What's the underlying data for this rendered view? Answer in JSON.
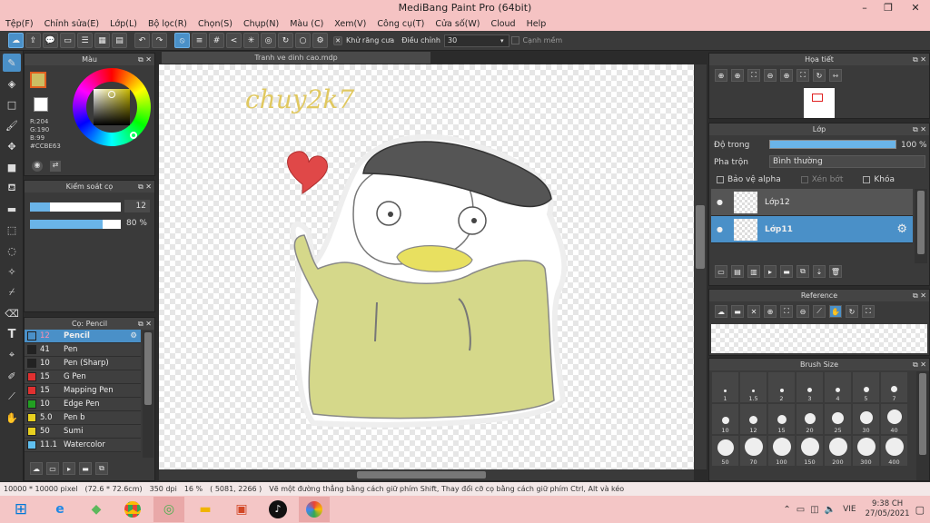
{
  "window": {
    "title": "MediBang Paint Pro (64bit)"
  },
  "menu": [
    "Tệp(F)",
    "Chỉnh sửa(E)",
    "Lớp(L)",
    "Bộ lọc(R)",
    "Chọn(S)",
    "Chụp(N)",
    "Màu (C)",
    "Xem(V)",
    "Công cụ(T)",
    "Cửa số(W)",
    "Cloud",
    "Help"
  ],
  "toolbar": {
    "antialias_label": "Khử răng cưa",
    "adjust_label": "Điều chỉnh",
    "adjust_value": "30",
    "edge_label": "Cạnh mềm"
  },
  "color_panel": {
    "title": "Màu",
    "r": "R:204",
    "g": "G:190",
    "b": "B:99",
    "hex": "#CCBE63"
  },
  "brush_control": {
    "title": "Kiểm soát cọ",
    "size": "12",
    "opacity": "80 %",
    "opacity_fraction": 0.8
  },
  "brush_panel": {
    "title": "Cọ: Pencil",
    "items": [
      {
        "size": "12",
        "name": "Pencil",
        "color": "#4a90c8"
      },
      {
        "size": "41",
        "name": "Pen",
        "color": "#222222"
      },
      {
        "size": "10",
        "name": "Pen (Sharp)",
        "color": "#222222"
      },
      {
        "size": "15",
        "name": "G Pen",
        "color": "#e03030"
      },
      {
        "size": "15",
        "name": "Mapping Pen",
        "color": "#e03030"
      },
      {
        "size": "10",
        "name": "Edge Pen",
        "color": "#22a022"
      },
      {
        "size": "5.0",
        "name": "Pen b",
        "color": "#e8d020"
      },
      {
        "size": "50",
        "name": "Sumi",
        "color": "#e8d020"
      },
      {
        "size": "11.1",
        "name": "Watercolor",
        "color": "#60c0f0"
      }
    ]
  },
  "document": {
    "tab": "Tranh ve dinh cao.mdp",
    "signature": "chuy2k7"
  },
  "navigator": {
    "title": "Họa tiết"
  },
  "layer_panel": {
    "title": "Lớp",
    "opacity_label": "Độ trong",
    "opacity_value": "100 %",
    "blend_label": "Pha trộn",
    "blend_value": "Bình thường",
    "protect_alpha": "Bảo vệ alpha",
    "clipping": "Xén bớt",
    "lock": "Khóa",
    "layers": [
      "Lớp12",
      "Lớp11"
    ]
  },
  "reference": {
    "title": "Reference"
  },
  "brush_size": {
    "title": "Brush Size",
    "sizes": [
      "1",
      "1.5",
      "2",
      "3",
      "4",
      "5",
      "7",
      "10",
      "12",
      "15",
      "20",
      "25",
      "30",
      "40",
      "50",
      "70",
      "100",
      "150",
      "200",
      "300",
      "400"
    ]
  },
  "status": {
    "dims": "10000 * 10000 pixel",
    "cm": "(72.6 * 72.6cm)",
    "dpi": "350 dpi",
    "zoom": "16 %",
    "coords": "( 5081, 2266 )",
    "hint": "Vẽ một đường thẳng bằng cách giữ phím Shift, Thay đổi cỡ cọ bằng cách giữ phím Ctrl, Alt và kéo"
  },
  "taskbar": {
    "lang": "VIE",
    "time": "9:38 CH",
    "date": "27/05/2021"
  }
}
